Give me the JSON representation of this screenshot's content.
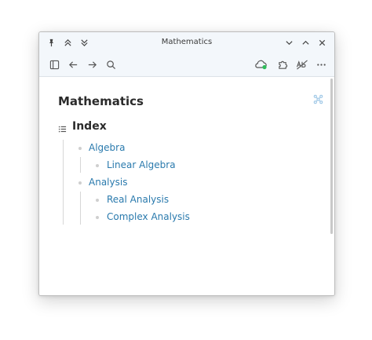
{
  "window": {
    "title": "Mathematics"
  },
  "titlebar": {
    "pin_icon": "pin-icon",
    "collapse_up_icon": "double-chevron-up-icon",
    "collapse_down_icon": "double-chevron-down-icon",
    "minimize_icon": "chevron-down-icon",
    "maximize_icon": "chevron-up-icon",
    "close_icon": "close-icon"
  },
  "toolbar": {
    "sidebar_icon": "sidebar-toggle-icon",
    "back_icon": "arrow-left-icon",
    "forward_icon": "arrow-right-icon",
    "search_icon": "search-icon",
    "sync_icon": "cloud-sync-icon",
    "plugins_icon": "puzzle-icon",
    "spellcheck_icon": "spellcheck-off-icon",
    "more_icon": "more-icon"
  },
  "note": {
    "title": "Mathematics",
    "heading": "Index",
    "items": [
      {
        "label": "Algebra",
        "children": [
          {
            "label": "Linear Algebra"
          }
        ]
      },
      {
        "label": "Analysis",
        "children": [
          {
            "label": "Real Analysis"
          },
          {
            "label": "Complex Analysis"
          }
        ]
      }
    ]
  },
  "colors": {
    "link": "#2a7aad",
    "sync_ok": "#2ebd5a",
    "titlebar_bg": "#f3f7fb"
  }
}
